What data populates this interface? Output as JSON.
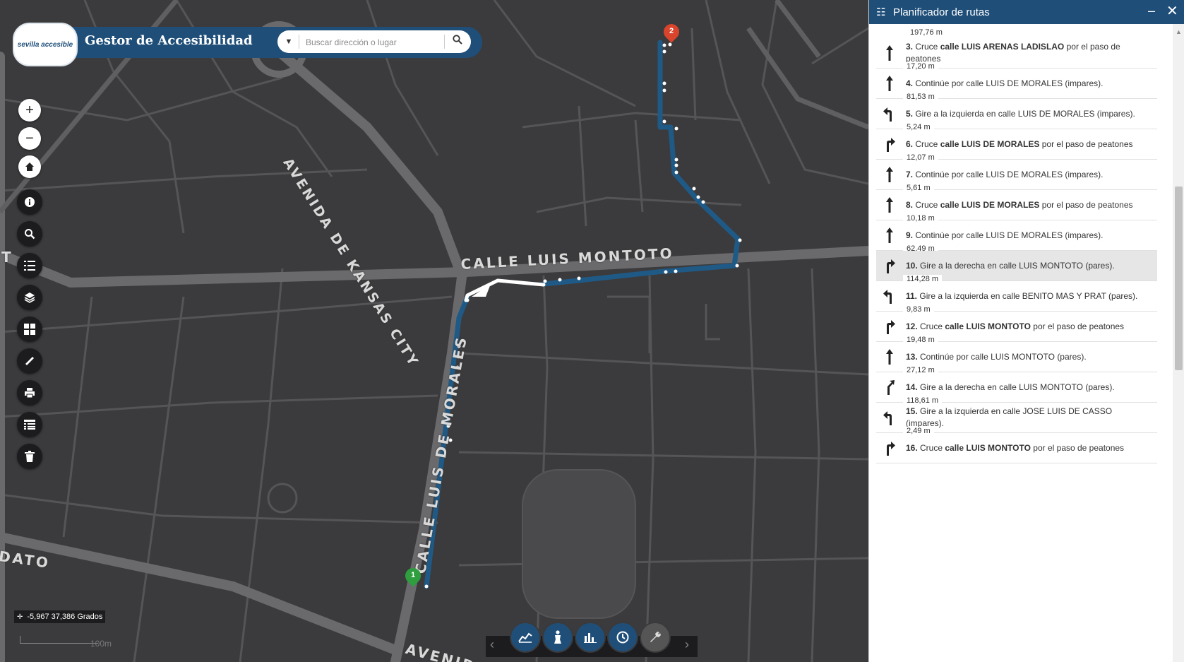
{
  "header": {
    "app_title": "Gestor de Accesibilidad",
    "logo_text": "sevilla accesible",
    "search_placeholder": "Buscar dirección o lugar"
  },
  "map": {
    "streets": {
      "avenida_kansas": "AVENIDA DE KANSAS CITY",
      "luis_montoto": "CALLE LUIS MONTOTO",
      "luis_de_morales": "CALLE LUIS DE MORALES",
      "avenida_bottom": "AVENIDA",
      "dato": "DATO",
      "t_left": "T"
    },
    "markers": {
      "start": "1",
      "end": "2"
    },
    "coordinates": "-5,967 37,386 Grados",
    "scale": "100m",
    "colors": {
      "route": "#1f5a87",
      "start": "#2e9e3e",
      "end": "#d9442c",
      "header": "#1f4f79"
    }
  },
  "toolbar": {
    "tools": [
      "zoom-in",
      "zoom-out",
      "home",
      "info",
      "search",
      "legend",
      "layers",
      "basemap-gallery",
      "measure",
      "print",
      "attribute-table",
      "clear"
    ]
  },
  "bottom_widgets": [
    "chart-icon",
    "accessibility-icon",
    "bar-chart-icon",
    "clock-icon",
    "wrench-icon"
  ],
  "panel": {
    "title": "Planificador de rutas",
    "first_distance": "197,76 m",
    "steps": [
      {
        "num": "3.",
        "pre": "Cruce ",
        "bold": "calle LUIS ARENAS LADISLAO",
        "post": " por el paso de peatones",
        "icon": "straight",
        "dist": "17,20 m"
      },
      {
        "num": "4.",
        "pre": "Continúe por calle LUIS DE MORALES (impares).",
        "bold": "",
        "post": "",
        "icon": "straight",
        "dist": "81,53 m"
      },
      {
        "num": "5.",
        "pre": "Gire a la izquierda en calle LUIS DE MORALES (impares).",
        "bold": "",
        "post": "",
        "icon": "left",
        "dist": "5,24 m"
      },
      {
        "num": "6.",
        "pre": "Cruce ",
        "bold": "calle LUIS DE MORALES",
        "post": " por el paso de peatones",
        "icon": "right",
        "dist": "12,07 m"
      },
      {
        "num": "7.",
        "pre": "Continúe por calle LUIS DE MORALES (impares).",
        "bold": "",
        "post": "",
        "icon": "straight",
        "dist": "5,61 m"
      },
      {
        "num": "8.",
        "pre": "Cruce ",
        "bold": "calle LUIS DE MORALES",
        "post": " por el paso de peatones",
        "icon": "straight",
        "dist": "10,18 m"
      },
      {
        "num": "9.",
        "pre": "Continúe por calle LUIS DE MORALES (impares).",
        "bold": "",
        "post": "",
        "icon": "straight",
        "dist": "62,49 m"
      },
      {
        "num": "10.",
        "pre": "Gire a la derecha en calle LUIS MONTOTO (pares).",
        "bold": "",
        "post": "",
        "icon": "right",
        "dist": "114,28 m",
        "highlight": true
      },
      {
        "num": "11.",
        "pre": "Gire a la izquierda en calle BENITO MAS Y PRAT (pares).",
        "bold": "",
        "post": "",
        "icon": "left",
        "dist": "9,83 m"
      },
      {
        "num": "12.",
        "pre": "Cruce ",
        "bold": "calle LUIS MONTOTO",
        "post": " por el paso de peatones",
        "icon": "right",
        "dist": "19,48 m"
      },
      {
        "num": "13.",
        "pre": "Continúe por calle LUIS MONTOTO (pares).",
        "bold": "",
        "post": "",
        "icon": "straight",
        "dist": "27,12 m"
      },
      {
        "num": "14.",
        "pre": "Gire a la derecha en calle LUIS MONTOTO (pares).",
        "bold": "",
        "post": "",
        "icon": "slight-right",
        "dist": "118,61 m"
      },
      {
        "num": "15.",
        "pre": "Gire a la izquierda en calle JOSE LUIS DE CASSO (impares).",
        "bold": "",
        "post": "",
        "icon": "left",
        "dist": "2,49 m"
      },
      {
        "num": "16.",
        "pre": "Cruce ",
        "bold": "calle LUIS MONTOTO",
        "post": " por el paso de peatones",
        "icon": "right",
        "dist": ""
      }
    ]
  }
}
